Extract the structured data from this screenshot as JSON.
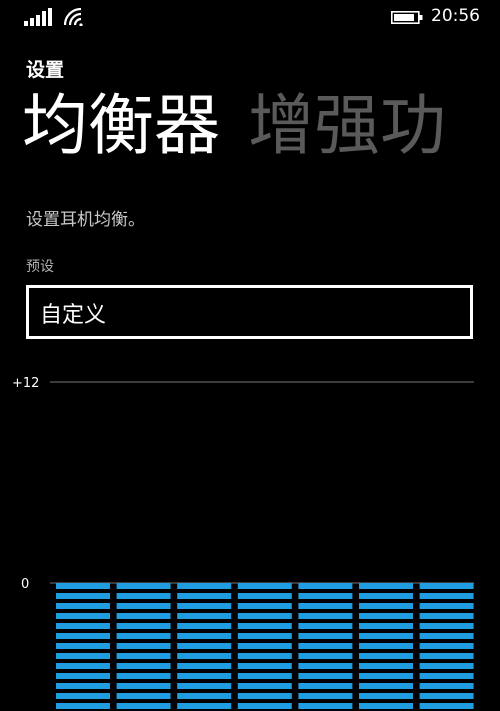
{
  "status": {
    "time": "20:56"
  },
  "header": {
    "app_title": "设置",
    "pivot_active": "均衡器",
    "pivot_next": "增强功"
  },
  "description": "设置耳机均衡。",
  "preset": {
    "label": "预设",
    "value": "自定义"
  },
  "colors": {
    "accent": "#1f9de0",
    "background": "#000000",
    "inactive": "#5a5a5a"
  },
  "chart_data": {
    "type": "bar",
    "tick_labels": [
      "+12",
      "0"
    ],
    "ylim": [
      -12,
      12
    ],
    "bands": [
      0,
      0,
      0,
      0,
      0,
      0,
      0
    ],
    "values": [
      0,
      0,
      0,
      0,
      0,
      0,
      0
    ]
  }
}
